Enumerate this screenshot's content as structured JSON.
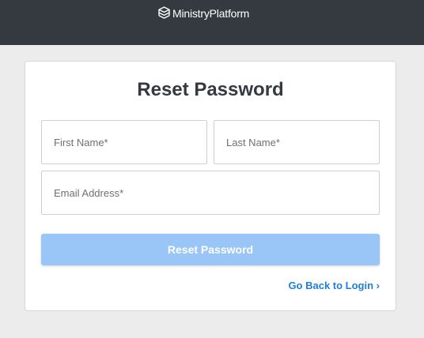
{
  "header": {
    "brand": "MinistryPlatform",
    "logo_icon": "stacked-layers-icon"
  },
  "form": {
    "title": "Reset Password",
    "first_name": {
      "placeholder": "First Name*",
      "value": ""
    },
    "last_name": {
      "placeholder": "Last Name*",
      "value": ""
    },
    "email": {
      "placeholder": "Email Address*",
      "value": ""
    },
    "submit_label": "Reset Password",
    "back_link_label": "Go Back to Login ›"
  },
  "colors": {
    "header_bg": "#343a40",
    "page_bg": "#ececec",
    "button_bg": "#99c6f6",
    "link": "#1f7fd8",
    "title": "#343a40"
  }
}
